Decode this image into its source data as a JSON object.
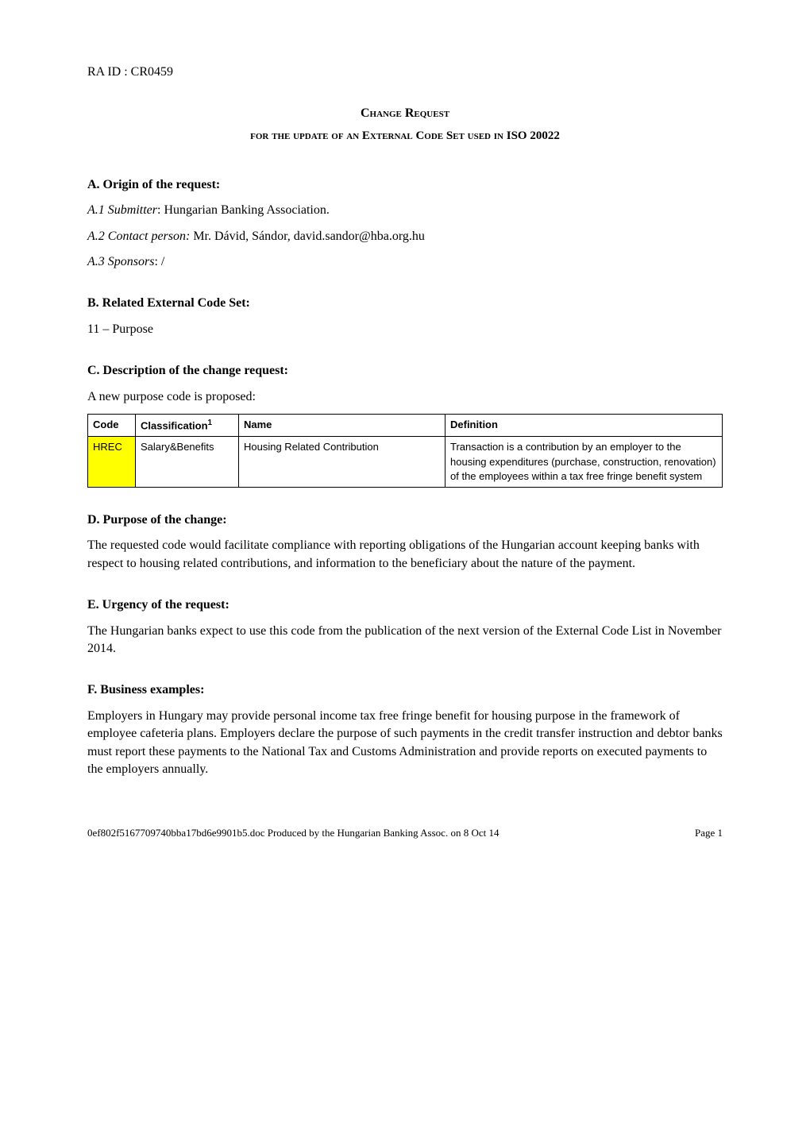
{
  "header": {
    "ra_id": "RA ID : CR0459"
  },
  "title": {
    "main": "Change Request",
    "sub_prefix": "for the update of an External Code Set used in ",
    "sub_iso": "ISO 20022"
  },
  "sections": {
    "A": {
      "heading": "A.  Origin of the request:",
      "a1_label": "A.1 Submitter",
      "a1_value": ": Hungarian Banking Association.",
      "a2_label": "A.2 Contact person:",
      "a2_value": " Mr. Dávid, Sándor, david.sandor@hba.org.hu",
      "a3_label": " A.3 Sponsors",
      "a3_value": ": /"
    },
    "B": {
      "heading": "B.  Related External Code Set:",
      "body": "11 – Purpose"
    },
    "C": {
      "heading": "C.  Description of the change request:",
      "intro": "A new purpose code is proposed:",
      "table": {
        "headers": {
          "code": "Code",
          "classification": "Classification",
          "classification_sup": "1",
          "name": "Name",
          "definition": "Definition"
        },
        "row": {
          "code": "HREC",
          "classification": "Salary&Benefits",
          "name": "Housing Related Contribution",
          "definition": "Transaction is a contribution by an employer to the housing expenditures (purchase, construction, renovation) of the employees within a tax free fringe benefit system"
        }
      }
    },
    "D": {
      "heading": "D.  Purpose of the change:",
      "body": "The requested code would facilitate compliance with reporting obligations of the Hungarian account keeping banks with respect to housing related contributions, and information to the beneficiary about the nature of the payment."
    },
    "E": {
      "heading": "E.  Urgency of the request:",
      "body": "The Hungarian banks expect to use this code from the publication of the next version of the External Code List in November 2014."
    },
    "F": {
      "heading": "F.  Business examples:",
      "body": "Employers in Hungary may provide personal income tax free fringe benefit for housing purpose in the framework of employee cafeteria plans. Employers declare the purpose of such payments in the credit transfer instruction and debtor banks must report these payments to the National Tax and Customs Administration and provide reports on executed payments to the employers annually."
    }
  },
  "footer": {
    "left": "0ef802f5167709740bba17bd6e9901b5.doc   Produced by the Hungarian Banking Assoc. on 8 Oct 14",
    "right": "Page 1"
  }
}
